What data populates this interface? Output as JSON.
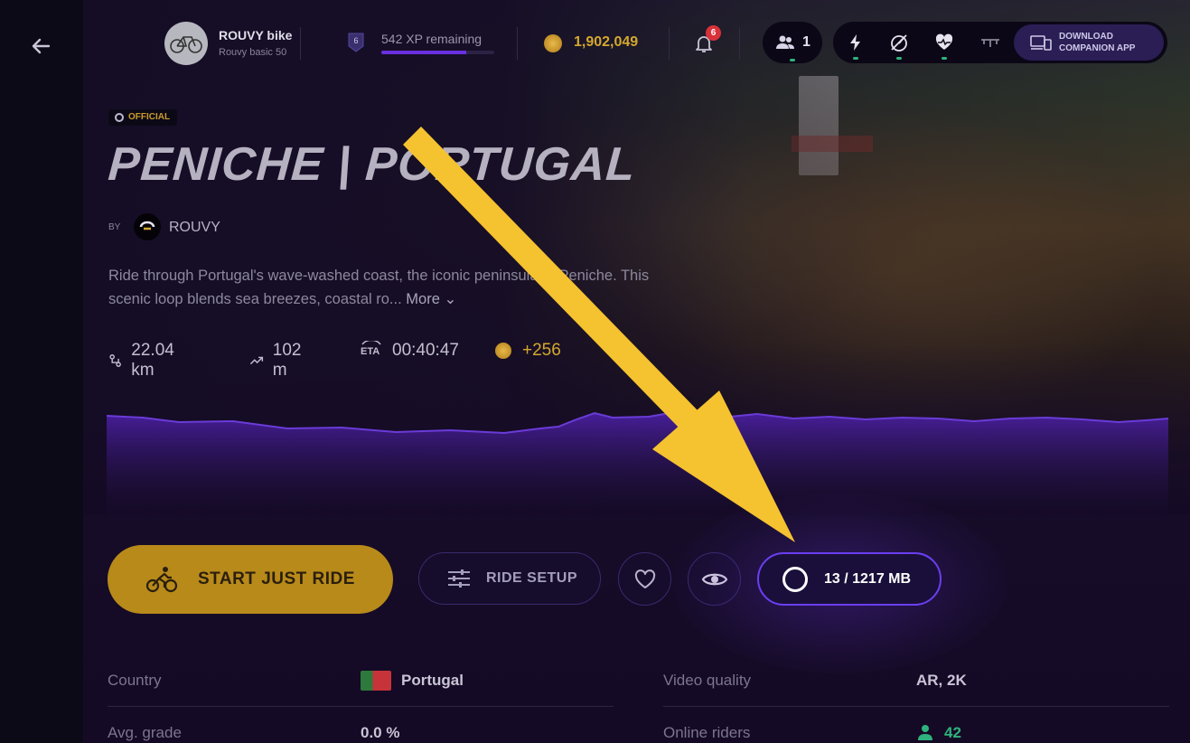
{
  "header": {
    "bike_name": "ROUVY bike",
    "bike_sub": "Rouvy basic 50",
    "level": "6",
    "xp_text": "542 XP remaining",
    "xp_progress": 0.75,
    "coins": "1,902,049",
    "notifications": "6",
    "riders_online": "1",
    "companion_line1": "DOWNLOAD",
    "companion_line2": "COMPANION APP"
  },
  "route": {
    "badge": "OFFICIAL",
    "title": "PENICHE | PORTUGAL",
    "by_label": "BY",
    "author": "ROUVY",
    "description": "Ride through Portugal's wave-washed coast, the iconic peninsula of Peniche. This scenic loop blends sea breezes, coastal ro...",
    "more_label": "More",
    "distance": "22.04 km",
    "elevation": "102 m",
    "eta": "00:40:47",
    "coins_reward": "+256"
  },
  "actions": {
    "start_label": "START JUST RIDE",
    "setup_label": "RIDE SETUP",
    "download_label": "13 / 1217 MB"
  },
  "details": {
    "country_label": "Country",
    "country_value": "Portugal",
    "grade_label": "Avg. grade",
    "grade_value": "0.0 %",
    "quality_label": "Video quality",
    "quality_value": "AR, 2K",
    "riders_label": "Online riders",
    "riders_value": "42"
  },
  "colors": {
    "accent_gold": "#b88a1a",
    "accent_purple": "#6a3ff0",
    "annotation_arrow": "#f5c230"
  }
}
